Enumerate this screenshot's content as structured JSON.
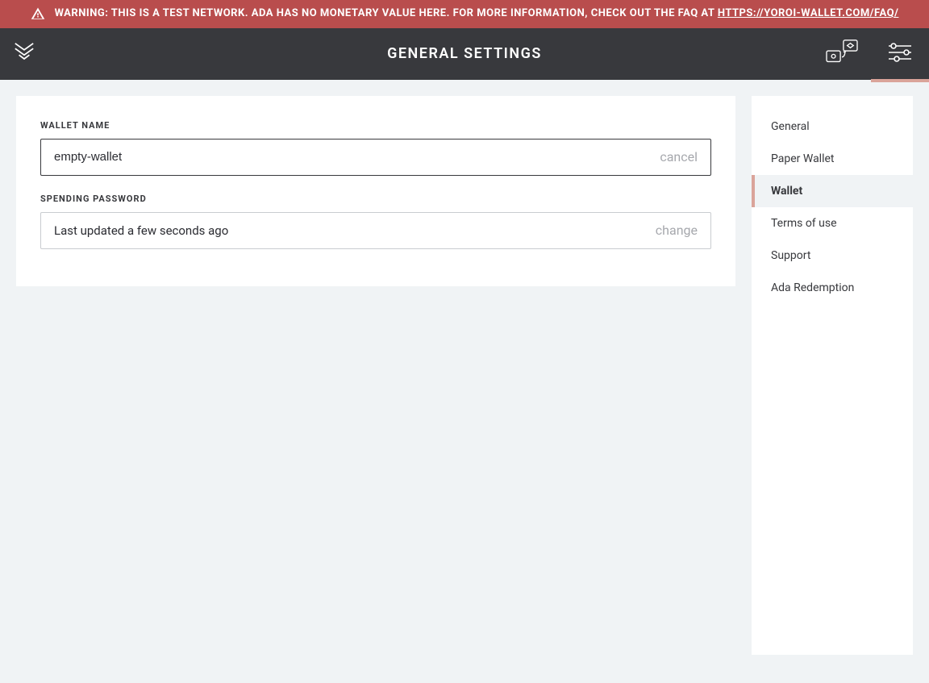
{
  "warning": {
    "text_prefix": "WARNING: THIS IS A TEST NETWORK. ADA HAS NO MONETARY VALUE HERE. FOR MORE INFORMATION, CHECK OUT THE FAQ AT ",
    "link_text": "HTTPS://YOROI-WALLET.COM/FAQ/"
  },
  "topbar": {
    "title": "GENERAL SETTINGS"
  },
  "walletName": {
    "label": "WALLET NAME",
    "value": "empty-wallet",
    "action": "cancel"
  },
  "spendingPassword": {
    "label": "SPENDING PASSWORD",
    "status": "Last updated a few seconds ago",
    "action": "change"
  },
  "sidebar": {
    "items": [
      {
        "label": "General"
      },
      {
        "label": "Paper Wallet"
      },
      {
        "label": "Wallet"
      },
      {
        "label": "Terms of use"
      },
      {
        "label": "Support"
      },
      {
        "label": "Ada Redemption"
      }
    ],
    "activeIndex": 2
  },
  "colors": {
    "warningBg": "#b94d4d",
    "topbarBg": "#38393d",
    "accent": "#daa49a",
    "pageBg": "#f0f3f5"
  }
}
